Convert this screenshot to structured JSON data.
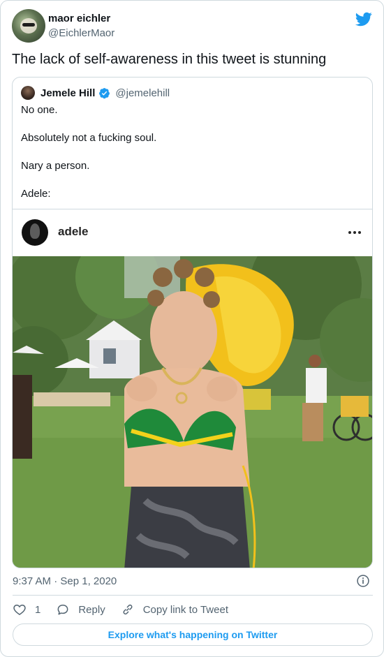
{
  "tweet": {
    "author_name": "maor eichler",
    "author_handle": "@EichlerMaor",
    "text": "The lack of self-awareness in this tweet is stunning",
    "timestamp": "9:37 AM · Sep 1, 2020",
    "like_count": "1",
    "reply_label": "Reply",
    "copy_link_label": "Copy link to Tweet",
    "explore_label": "Explore what's happening on Twitter"
  },
  "quote": {
    "author_name": "Jemele Hill",
    "author_handle": "@jemelehill",
    "lines": [
      "No one.",
      "Absolutely not a fucking soul.",
      "Nary a person.",
      "Adele:"
    ]
  },
  "embed": {
    "username": "adele"
  },
  "colors": {
    "accent": "#1d9bf0",
    "text": "#0f1419",
    "muted": "#536471",
    "border": "#cfd9de"
  },
  "icons": {
    "logo": "twitter-bird-icon",
    "verified": "verified-badge-icon",
    "more": "more-dots-icon",
    "info": "info-icon",
    "like": "heart-icon",
    "reply": "reply-bubble-icon",
    "link": "link-icon"
  }
}
